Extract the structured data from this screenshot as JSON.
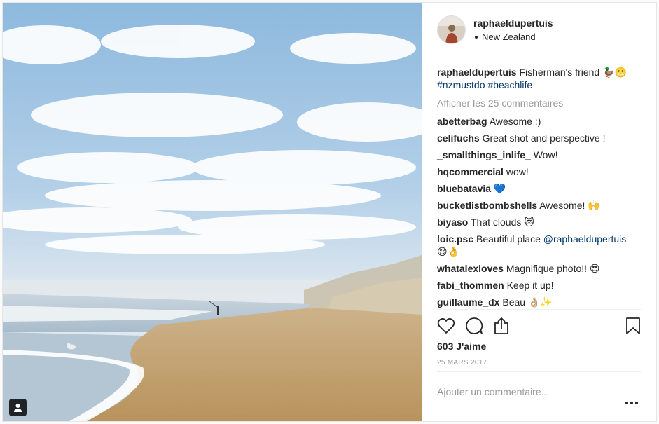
{
  "header": {
    "username": "raphaeldupertuis",
    "location": "New Zealand"
  },
  "caption": {
    "user": "raphaeldupertuis",
    "text": "Fisherman's friend 🦆😬",
    "hashtags": "#nzmustdo #beachlife"
  },
  "view_all_label": "Afficher les 25 commentaires",
  "comments": [
    {
      "user": "abetterbag",
      "text": "Awesome :)"
    },
    {
      "user": "celifuchs",
      "text": "Great shot and perspective !"
    },
    {
      "user": "_smallthings_inlife_",
      "text": "Wow!"
    },
    {
      "user": "hqcommercial",
      "text": "wow!"
    },
    {
      "user": "bluebatavia",
      "text": "💙"
    },
    {
      "user": "bucketlistbombshells",
      "text": "Awesome! 🙌"
    },
    {
      "user": "biyaso",
      "text": "That clouds 😻"
    },
    {
      "user": "loic.psc",
      "text": "Beautiful place",
      "mention": "@raphaeldupertuis",
      "after": "😌👌"
    },
    {
      "user": "whatalexloves",
      "text": "Magnifique photo!! 😍"
    },
    {
      "user": "fabi_thommen",
      "text": "Keep it up!"
    },
    {
      "user": "guillaume_dx",
      "text": "Beau 👌🏼✨"
    }
  ],
  "likes": "603 J'aime",
  "date": "25 MARS 2017",
  "add_comment_placeholder": "Ajouter un commentaire...",
  "icons": {
    "like": "heart-icon",
    "comment": "comment-icon",
    "share": "share-icon",
    "save": "bookmark-icon",
    "more": "more-options-icon",
    "tag": "user-tag-icon"
  }
}
